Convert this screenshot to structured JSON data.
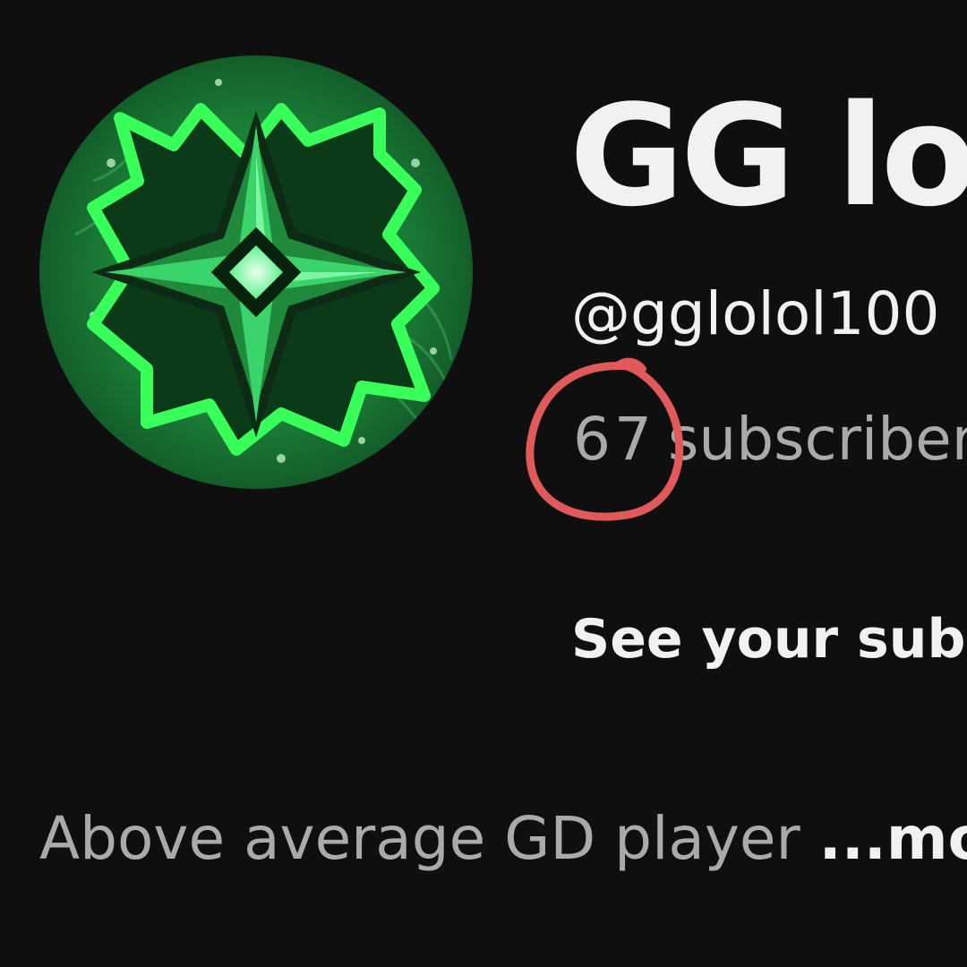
{
  "channel": {
    "name": "GG lol",
    "handle": "@gglolol100",
    "subscriber_count": "67",
    "subscriber_label": "subscribers",
    "see_subs_link": "See your subscribers",
    "description": "Above average GD player",
    "more_label": "...more"
  },
  "annotation": {
    "type": "hand-drawn circle",
    "target": "subscriber_count",
    "color": "#e05a5a"
  },
  "colors": {
    "background": "#0f0f0f",
    "primary_text": "#f1f1f1",
    "secondary_text": "#aaaaaa",
    "avatar_accent": "#19e33a"
  },
  "avatar": {
    "icon": "green-four-point-star-logo"
  }
}
